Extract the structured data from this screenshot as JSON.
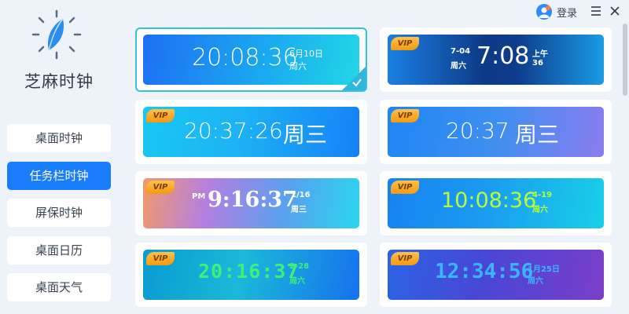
{
  "app": {
    "name": "芝麻时钟"
  },
  "sidebar": {
    "items": [
      {
        "label": "桌面时钟",
        "active": false
      },
      {
        "label": "任务栏时钟",
        "active": true
      },
      {
        "label": "屏保时钟",
        "active": false
      },
      {
        "label": "桌面日历",
        "active": false
      },
      {
        "label": "桌面天气",
        "active": false
      }
    ]
  },
  "topbar": {
    "login_label": "登录"
  },
  "colors": {
    "accent": "#1a7dfc",
    "selected_border": "#38c0e0",
    "vip": "#f6a623"
  },
  "vip_label": "VIP",
  "clocks": [
    {
      "time": "20:08:36",
      "date": "6月10日",
      "weekday": "周六",
      "vip": false,
      "selected": true
    },
    {
      "date": "7-04",
      "weekday": "周六",
      "time": "7:08",
      "ampm": "上午",
      "seconds": "36",
      "vip": true
    },
    {
      "time": "20:37:26",
      "weekday": "周三",
      "vip": true
    },
    {
      "time": "20:37",
      "weekday": "周三",
      "vip": true
    },
    {
      "ampm": "PM",
      "time": "9:16:37",
      "date": "1/16",
      "weekday": "周三",
      "vip": true
    },
    {
      "time": "10:08:36",
      "date": "4-19",
      "weekday": "周六",
      "vip": true
    },
    {
      "time": "20:16:37",
      "date": "2-28",
      "weekday": "周六",
      "vip": true
    },
    {
      "time": "12:34:56",
      "date": "1月25日",
      "weekday": "周六",
      "vip": true
    }
  ],
  "scrollbar": {
    "position_fraction": 0.0
  }
}
